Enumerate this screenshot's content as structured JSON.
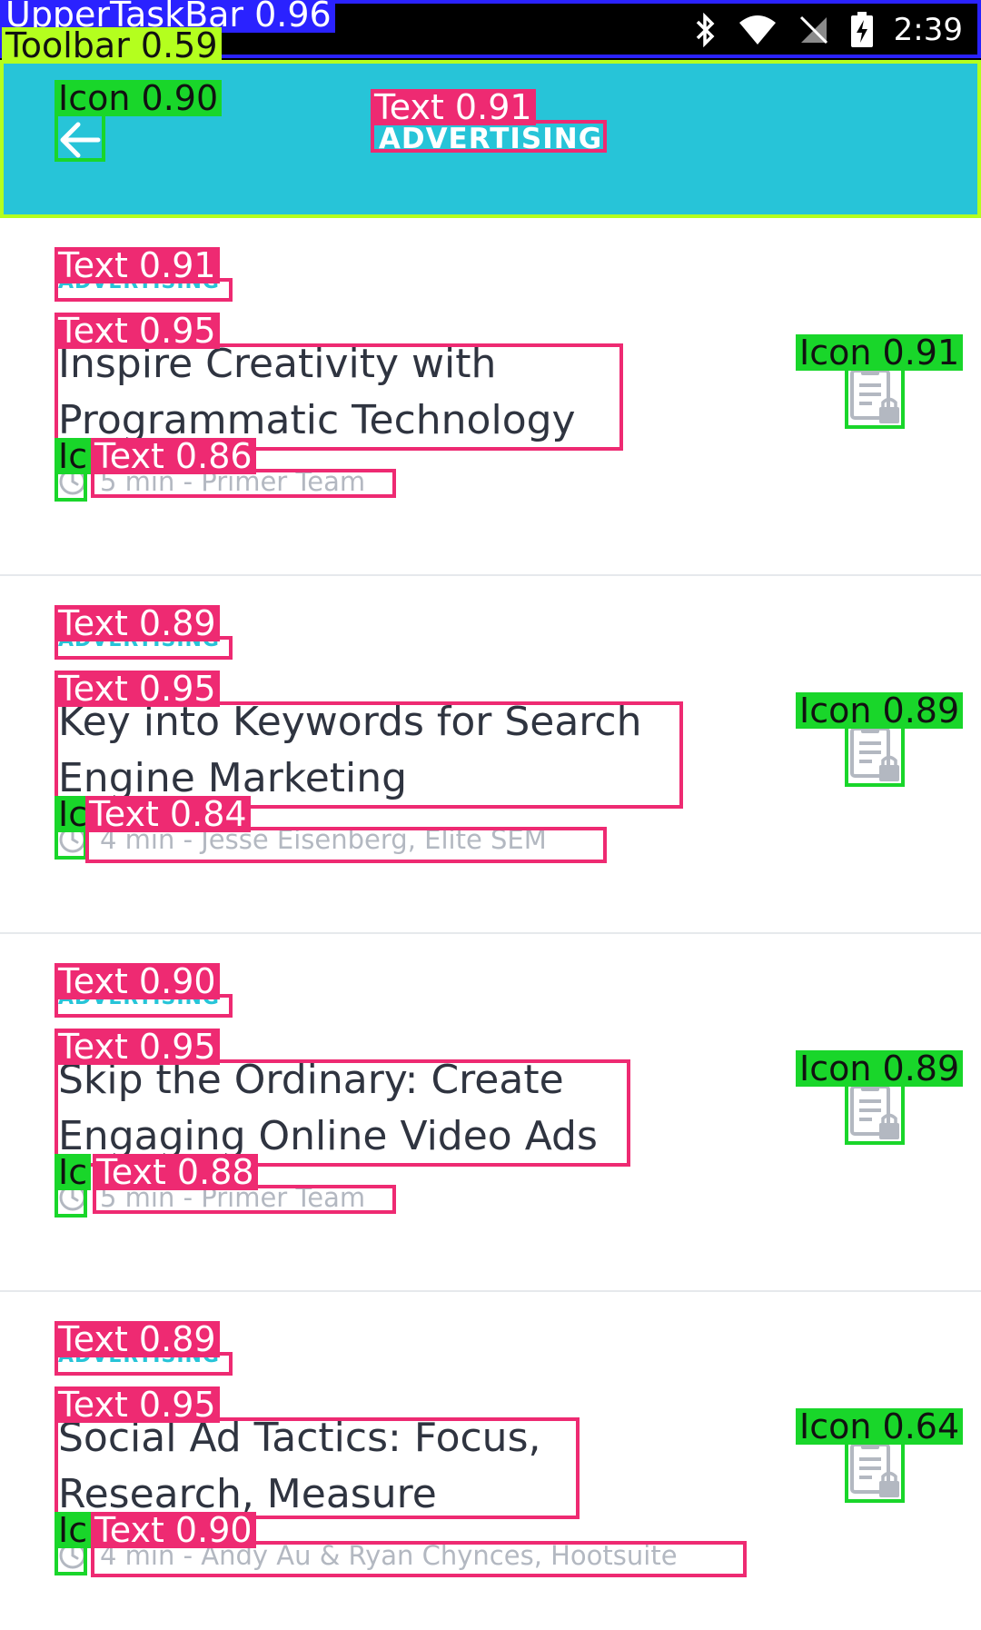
{
  "status_bar": {
    "time": "2:39",
    "icons": [
      "photo-icon",
      "satellite-icon",
      "info-circle-icon",
      "android-icon",
      "bluetooth-icon",
      "wifi-icon",
      "no-sim-icon",
      "battery-charging-icon"
    ]
  },
  "toolbar": {
    "title": "ADVERTISING",
    "back_icon": "arrow-left-icon",
    "background": "#27c4d8"
  },
  "articles": [
    {
      "category": "ADVERTISING",
      "title": "Inspire Creativity with Programmatic Technology",
      "meta": "5 min - Primer Team"
    },
    {
      "category": "ADVERTISING",
      "title": "Key into Keywords for Search Engine Marketing",
      "meta": "4 min - Jesse Eisenberg, Elite SEM"
    },
    {
      "category": "ADVERTISING",
      "title": "Skip the Ordinary: Create Engaging Online Video Ads",
      "meta": "5 min - Primer Team"
    },
    {
      "category": "ADVERTISING",
      "title": "Social Ad Tactics: Focus, Research, Measure",
      "meta": "4 min - Andy Au & Ryan Chynces, Hootsuite"
    }
  ],
  "colors": {
    "accent": "#27c4d8",
    "title_text": "#2f3440",
    "meta_text": "#b3b8c1"
  },
  "overlay_labels": {
    "upper_taskbar": "UpperTaskBar 0.96",
    "toolbar": "Toolbar 0.59",
    "back_icon": "Icon 0.90",
    "toolbar_title": "Text 0.91",
    "cards": [
      {
        "category": "Text 0.91",
        "title": "Text 0.95",
        "clock": "Ic",
        "meta": "Text 0.86",
        "lock": "Icon 0.91"
      },
      {
        "category": "Text 0.89",
        "title": "Text 0.95",
        "clock": "Ic",
        "meta": "Text 0.84",
        "lock": "Icon 0.89"
      },
      {
        "category": "Text 0.90",
        "title": "Text 0.95",
        "clock": "Ic",
        "meta": "Text 0.88",
        "lock": "Icon 0.89"
      },
      {
        "category": "Text 0.89",
        "title": "Text 0.95",
        "clock": "Ic",
        "meta": "Text 0.90",
        "lock": "Icon 0.64"
      }
    ]
  }
}
